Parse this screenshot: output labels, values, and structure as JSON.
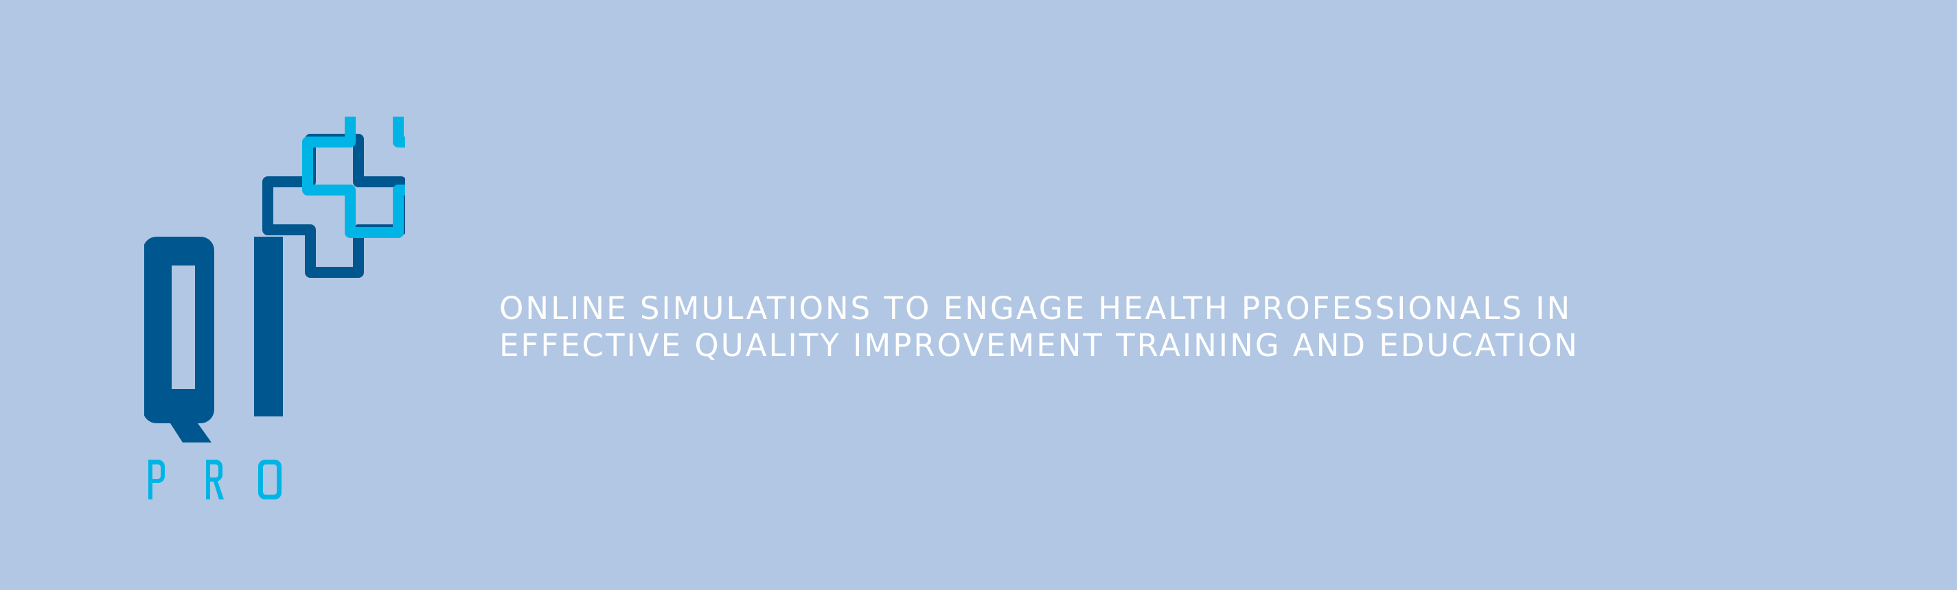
{
  "colors": {
    "background": "#b2c7e3",
    "logo_dark": "#00568f",
    "logo_light": "#00b5e5",
    "text": "#ffffff"
  },
  "logo": {
    "icon": "qi-pro-medical-cross-logo",
    "wordmark": "QI PRO"
  },
  "tagline": {
    "line1": "ONLINE SIMULATIONS TO ENGAGE HEALTH PROFESSIONALS IN",
    "line2": "EFFECTIVE QUALITY IMPROVEMENT TRAINING AND EDUCATION"
  }
}
